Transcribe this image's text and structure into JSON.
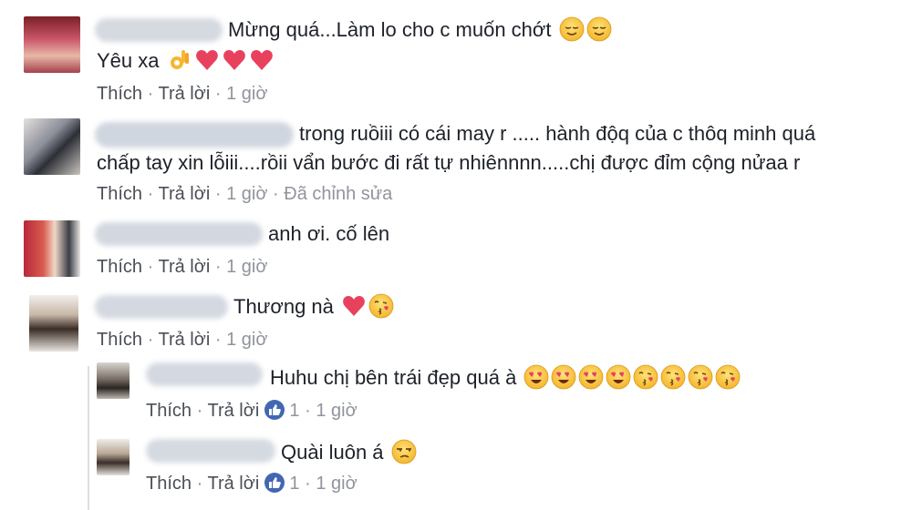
{
  "comments": [
    {
      "text": "Mừng quá...Làm lo cho c muốn chớt",
      "text2": "Yêu xa",
      "actions": {
        "like": "Thích",
        "reply": "Trả lời",
        "time": "1 giờ"
      },
      "emojis": [
        "relieved-face",
        "relieved-face"
      ],
      "emojis2": [
        "ok-hand",
        "red-heart",
        "red-heart",
        "red-heart"
      ]
    },
    {
      "text": "trong ruồiii có cái may r ..... hành độq của c thôq minh quá",
      "text2": "chấp tay xin lỗiii....rồii vẩn bước đi rất tự nhiênnnn.....chị được đỉm cộng nửaa r",
      "actions": {
        "like": "Thích",
        "reply": "Trả lời",
        "time": "1 giờ",
        "edited": "Đã chỉnh sửa"
      }
    },
    {
      "text": "anh ơi. cố lên",
      "actions": {
        "like": "Thích",
        "reply": "Trả lời",
        "time": "1 giờ"
      }
    },
    {
      "text": "Thương nà",
      "emojis": [
        "red-heart",
        "kissing-face"
      ],
      "actions": {
        "like": "Thích",
        "reply": "Trả lời",
        "time": "1 giờ"
      }
    }
  ],
  "replies": [
    {
      "text": "Huhu chị bên trái đẹp quá à",
      "emojis": [
        "heart-eyes-face",
        "heart-eyes-face",
        "heart-eyes-face",
        "heart-eyes-face",
        "kissing-face",
        "kissing-face",
        "kissing-face",
        "kissing-face"
      ],
      "actions": {
        "like": "Thích",
        "reply": "Trả lời",
        "likes": "1",
        "time": "1 giờ"
      }
    },
    {
      "text": "Quài luôn á",
      "emojis": [
        "unamused-face"
      ],
      "actions": {
        "like": "Thích",
        "reply": "Trả lời",
        "likes": "1",
        "time": "1 giờ"
      }
    }
  ],
  "separator": "·",
  "colors": {
    "text": "#1d2129",
    "meta": "#90949c",
    "link": "#4b4f56",
    "like_blue": "#4267b2"
  }
}
